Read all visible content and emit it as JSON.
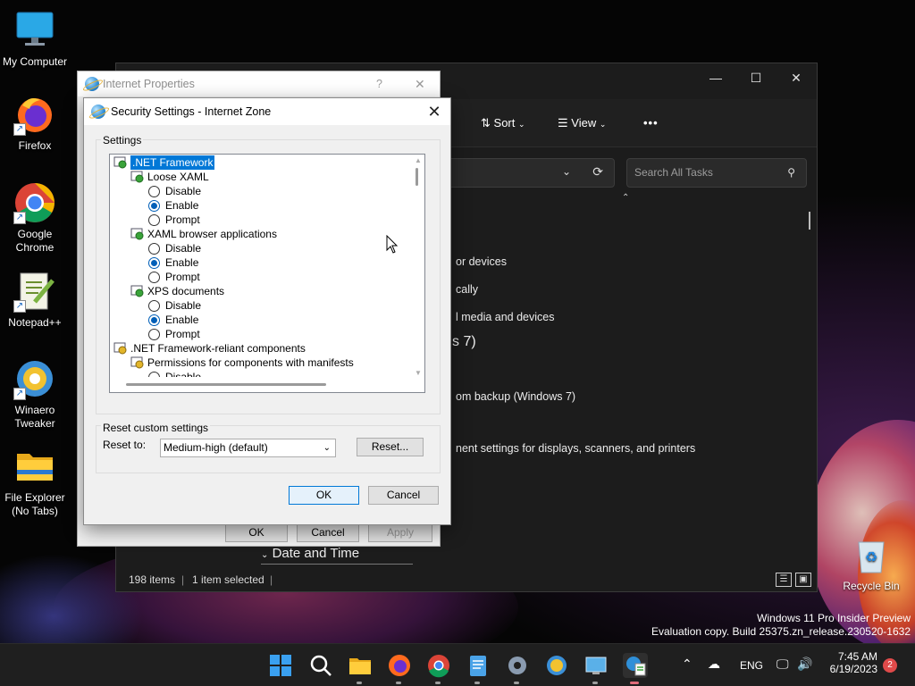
{
  "desktop": {
    "icons": [
      {
        "label": "My Computer"
      },
      {
        "label": "Firefox"
      },
      {
        "label": "Google Chrome"
      },
      {
        "label": "Notepad++"
      },
      {
        "label": "Winaero Tweaker"
      },
      {
        "label": "File Explorer (No Tabs)"
      },
      {
        "label": "Recycle Bin"
      }
    ],
    "watermark_line1": "Windows 11 Pro Insider Preview",
    "watermark_line2": "Evaluation copy. Build 25375.zn_release.230520-1632"
  },
  "explorer": {
    "toolbar": {
      "sort_label": "Sort",
      "view_label": "View",
      "more_label": "•••"
    },
    "search_placeholder": "Search All Tasks",
    "visible_items": [
      "or devices",
      "cally",
      "l media and devices",
      "s 7)",
      "om backup (Windows 7)",
      "nent settings for displays, scanners, and printers",
      "Date and Time"
    ],
    "status": {
      "items_count": "198 items",
      "selected": "1 item selected",
      "separator": "|"
    }
  },
  "internet_properties": {
    "title": "Internet Properties",
    "help": "?",
    "close": "✕",
    "buttons": {
      "ok": "OK",
      "cancel": "Cancel",
      "apply": "Apply"
    }
  },
  "security_settings": {
    "title": "Security Settings - Internet Zone",
    "close": "✕",
    "settings_group_label": "Settings",
    "tree": [
      {
        "type": "group",
        "label": ".NET Framework",
        "selected": true
      },
      {
        "type": "setting",
        "label": "Loose XAML"
      },
      {
        "type": "option",
        "label": "Disable",
        "checked": false
      },
      {
        "type": "option",
        "label": "Enable",
        "checked": true
      },
      {
        "type": "option",
        "label": "Prompt",
        "checked": false
      },
      {
        "type": "setting",
        "label": "XAML browser applications"
      },
      {
        "type": "option",
        "label": "Disable",
        "checked": false
      },
      {
        "type": "option",
        "label": "Enable",
        "checked": true
      },
      {
        "type": "option",
        "label": "Prompt",
        "checked": false
      },
      {
        "type": "setting",
        "label": "XPS documents"
      },
      {
        "type": "option",
        "label": "Disable",
        "checked": false
      },
      {
        "type": "option",
        "label": "Enable",
        "checked": true
      },
      {
        "type": "option",
        "label": "Prompt",
        "checked": false
      },
      {
        "type": "group",
        "label": ".NET Framework-reliant components"
      },
      {
        "type": "setting",
        "label": "Permissions for components with manifests"
      },
      {
        "type": "option",
        "label": "Disable",
        "checked": false
      }
    ],
    "reset_group_label": "Reset custom settings",
    "reset_to_label": "Reset to:",
    "reset_to_value": "Medium-high (default)",
    "reset_button": "Reset...",
    "ok_button": "OK",
    "cancel_button": "Cancel"
  },
  "taskbar": {
    "apps": [
      "start-icon",
      "search-icon",
      "file-explorer-icon",
      "firefox-icon",
      "chrome-icon",
      "notepad-icon",
      "settings-icon",
      "winaero-icon",
      "control-panel-icon",
      "internet-options-icon"
    ],
    "language": "ENG",
    "time": "7:45 AM",
    "date": "6/19/2023",
    "notification_count": "2"
  }
}
